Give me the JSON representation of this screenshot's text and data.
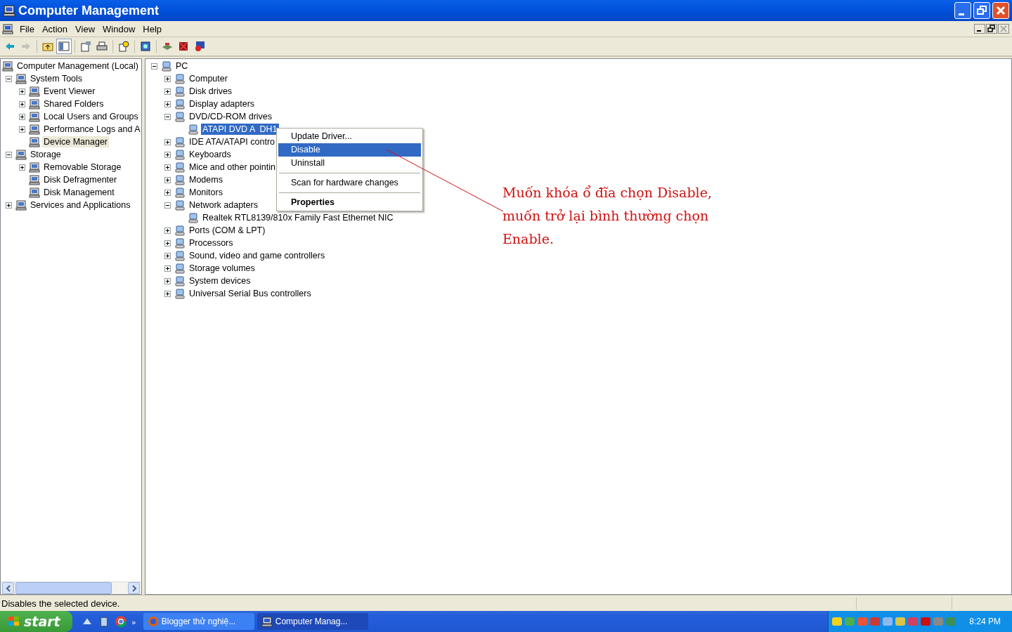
{
  "window": {
    "title": "Computer Management"
  },
  "menu": [
    "File",
    "Action",
    "View",
    "Window",
    "Help"
  ],
  "toolbar": [
    {
      "kind": "back",
      "disabled": false,
      "pressed": false
    },
    {
      "kind": "forward",
      "disabled": true,
      "pressed": false
    },
    {
      "kind": "sep"
    },
    {
      "kind": "up",
      "disabled": false,
      "pressed": false
    },
    {
      "kind": "tree",
      "disabled": false,
      "pressed": true
    },
    {
      "kind": "sep"
    },
    {
      "kind": "properties",
      "disabled": false,
      "pressed": false
    },
    {
      "kind": "print",
      "disabled": false,
      "pressed": false
    },
    {
      "kind": "sep"
    },
    {
      "kind": "help",
      "disabled": false,
      "pressed": false
    },
    {
      "kind": "sep"
    },
    {
      "kind": "scan",
      "disabled": false,
      "pressed": false
    },
    {
      "kind": "sep"
    },
    {
      "kind": "update",
      "disabled": false,
      "pressed": false
    },
    {
      "kind": "uninstall",
      "disabled": false,
      "pressed": false
    },
    {
      "kind": "disable",
      "disabled": false,
      "pressed": false
    }
  ],
  "console_tree": [
    {
      "label": "Computer Management (Local)",
      "selected": false,
      "children": [
        {
          "label": "System Tools",
          "expanded": true,
          "selected": false,
          "children": [
            {
              "label": "Event Viewer",
              "expanded": false,
              "selected": false
            },
            {
              "label": "Shared Folders",
              "expanded": false,
              "selected": false
            },
            {
              "label": "Local Users and Groups",
              "expanded": false,
              "selected": false
            },
            {
              "label": "Performance Logs and A",
              "expanded": false,
              "selected": false
            },
            {
              "label": "Device Manager",
              "selected": true
            }
          ]
        },
        {
          "label": "Storage",
          "expanded": true,
          "selected": false,
          "children": [
            {
              "label": "Removable Storage",
              "expanded": false,
              "selected": false
            },
            {
              "label": "Disk Defragmenter",
              "selected": false
            },
            {
              "label": "Disk Management",
              "selected": false
            }
          ]
        },
        {
          "label": "Services and Applications",
          "expanded": false,
          "selected": false
        }
      ]
    }
  ],
  "device_tree": [
    {
      "label": "PC",
      "expanded": true,
      "selected": false,
      "children": [
        {
          "label": "Computer",
          "expanded": false,
          "selected": false
        },
        {
          "label": "Disk drives",
          "expanded": false,
          "selected": false
        },
        {
          "label": "Display adapters",
          "expanded": false,
          "selected": false
        },
        {
          "label": "DVD/CD-ROM drives",
          "expanded": true,
          "selected": false,
          "children": [
            {
              "label": "ATAPI DVD A  DH1",
              "selected": true
            }
          ]
        },
        {
          "label": "IDE ATA/ATAPI contro",
          "expanded": false,
          "selected": false
        },
        {
          "label": "Keyboards",
          "expanded": false,
          "selected": false
        },
        {
          "label": "Mice and other pointin",
          "expanded": false,
          "selected": false
        },
        {
          "label": "Modems",
          "expanded": false,
          "selected": false
        },
        {
          "label": "Monitors",
          "expanded": false,
          "selected": false
        },
        {
          "label": "Network adapters",
          "expanded": true,
          "selected": false,
          "children": [
            {
              "label": "Realtek RTL8139/810x Family Fast Ethernet NIC",
              "selected": false
            }
          ]
        },
        {
          "label": "Ports (COM & LPT)",
          "expanded": false,
          "selected": false
        },
        {
          "label": "Processors",
          "expanded": false,
          "selected": false
        },
        {
          "label": "Sound, video and game controllers",
          "expanded": false,
          "selected": false
        },
        {
          "label": "Storage volumes",
          "expanded": false,
          "selected": false
        },
        {
          "label": "System devices",
          "expanded": false,
          "selected": false
        },
        {
          "label": "Universal Serial Bus controllers",
          "expanded": false,
          "selected": false
        }
      ]
    }
  ],
  "context_menu": [
    {
      "kind": "item",
      "label": "Update Driver...",
      "selected": false,
      "default": false
    },
    {
      "kind": "item",
      "label": "Disable",
      "selected": true,
      "default": false
    },
    {
      "kind": "item",
      "label": "Uninstall",
      "selected": false,
      "default": false
    },
    {
      "kind": "separator"
    },
    {
      "kind": "item",
      "label": "Scan for hardware changes",
      "selected": false,
      "default": false
    },
    {
      "kind": "separator"
    },
    {
      "kind": "item",
      "label": "Properties",
      "selected": false,
      "default": true
    }
  ],
  "annotation": {
    "lines": [
      "Muốn khóa ổ đĩa chọn Disable,",
      "muốn trở lại bình thường chọn",
      "Enable."
    ]
  },
  "status_bar": "Disables the selected device.",
  "taskbar": {
    "start": "start",
    "chevron": "»",
    "tasks": [
      {
        "label": "Blogger thử nghiệ...",
        "selected": false
      },
      {
        "label": "Computer Manag...",
        "selected": true
      }
    ],
    "clock": "8:24 PM"
  }
}
